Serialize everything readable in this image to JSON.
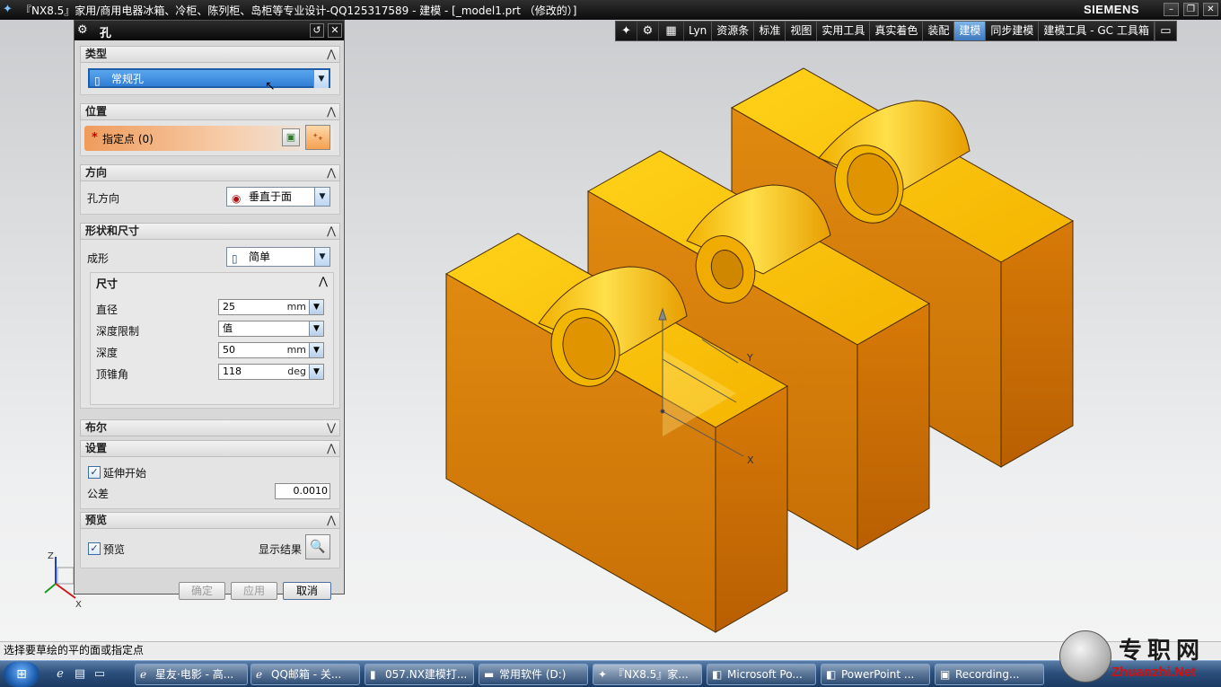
{
  "window": {
    "title": "『NX8.5』家用/商用电器冰箱、冷柜、陈列柜、岛柜等专业设计-QQ125317589 - 建模 - [_model1.prt （修改的）]",
    "brand": "SIEMENS"
  },
  "ribbon": {
    "tabs": [
      "Lyn",
      "资源条",
      "标准",
      "视图",
      "实用工具",
      "真实着色",
      "装配",
      "建模",
      "同步建模",
      "建模工具 - GC 工具箱"
    ],
    "active_tab": "建模"
  },
  "dialog": {
    "title": "孔",
    "sections": {
      "type": {
        "header": "类型",
        "value": "常规孔"
      },
      "position": {
        "header": "位置",
        "specify_point": "指定点 (0)"
      },
      "direction": {
        "header": "方向",
        "hole_direction_label": "孔方向",
        "hole_direction_value": "垂直于面"
      },
      "form_dims": {
        "header": "形状和尺寸",
        "form_label": "成形",
        "form_value": "简单",
        "dimensions_header": "尺寸",
        "diameter_label": "直径",
        "diameter_value": "25",
        "diameter_unit": "mm",
        "depth_limit_label": "深度限制",
        "depth_limit_value": "值",
        "depth_label": "深度",
        "depth_value": "50",
        "depth_unit": "mm",
        "tip_angle_label": "顶锥角",
        "tip_angle_value": "118",
        "tip_angle_unit": "deg"
      },
      "boolean": {
        "header": "布尔"
      },
      "settings": {
        "header": "设置",
        "extend_start_label": "延伸开始",
        "extend_start_checked": true,
        "tolerance_label": "公差",
        "tolerance_value": "0.0010"
      },
      "preview": {
        "header": "预览",
        "preview_label": "预览",
        "preview_checked": true,
        "show_result_label": "显示结果"
      }
    },
    "buttons": {
      "ok": "确定",
      "apply": "应用",
      "cancel": "取消"
    }
  },
  "viewport": {
    "csys_y": "Y",
    "csys_x": "X",
    "triad_z": "Z",
    "triad_x": "X",
    "part_color": "#f2b300"
  },
  "status": {
    "prompt": "选择要草绘的平的面或指定点"
  },
  "taskbar": {
    "tasks": [
      "星友·电影 - 高...",
      "QQ邮箱 - 关...",
      "057.NX建模打...",
      "常用软件 (D:)",
      "『NX8.5』家...",
      "Microsoft Po...",
      "PowerPoint ...",
      "Recording..."
    ]
  },
  "watermark": {
    "name": "专职网",
    "url": "Zhuanzhi.Net"
  }
}
